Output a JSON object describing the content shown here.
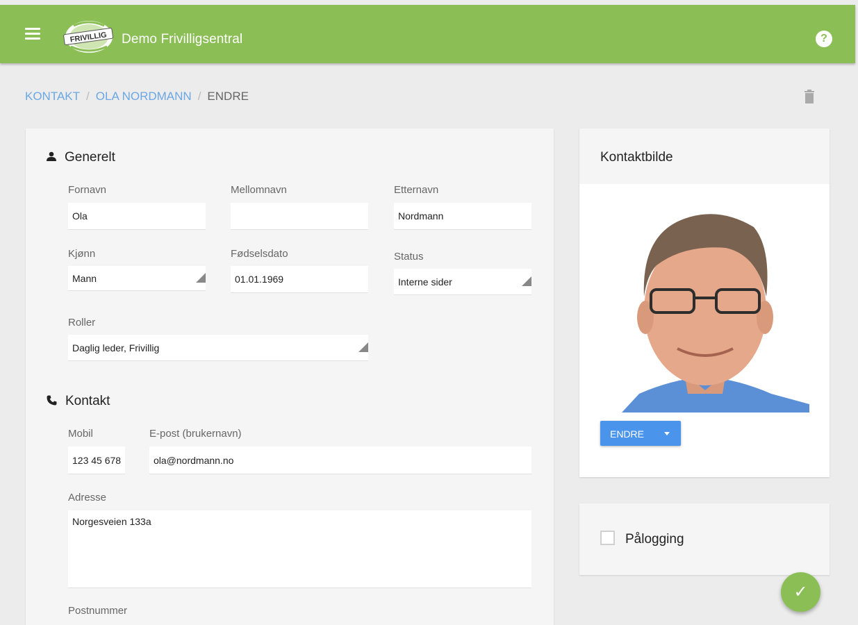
{
  "app": {
    "title": "Demo Frivilligsentral",
    "logo_text": "FRIVILLIG",
    "help_glyph": "?",
    "colors": {
      "accent": "#8bbf55",
      "link": "#6aa7e4",
      "primary_button": "#4a94ec"
    }
  },
  "breadcrumb": [
    {
      "label": "KONTAKT"
    },
    {
      "label": "OLA NORDMANN"
    },
    {
      "label": "ENDRE"
    }
  ],
  "general": {
    "title": "Generelt",
    "fornavn": {
      "label": "Fornavn",
      "value": "Ola"
    },
    "mellomnavn": {
      "label": "Mellomnavn",
      "value": ""
    },
    "etternavn": {
      "label": "Etternavn",
      "value": "Nordmann"
    },
    "kjonn": {
      "label": "Kjønn",
      "value": "Mann"
    },
    "fodselsdato": {
      "label": "Fødselsdato",
      "value": "01.01.1969"
    },
    "status": {
      "label": "Status",
      "value": "Interne sider"
    },
    "roller": {
      "label": "Roller",
      "value": "Daglig leder, Frivillig"
    }
  },
  "contact": {
    "title": "Kontakt",
    "mobil": {
      "label": "Mobil",
      "value": "123 45 678"
    },
    "epost": {
      "label": "E-post (brukernavn)",
      "value": "ola@nordmann.no"
    },
    "adresse": {
      "label": "Adresse",
      "value": "Norgesveien 133a"
    },
    "postnummer": {
      "label": "Postnummer"
    }
  },
  "photo_panel": {
    "title": "Kontaktbilde",
    "button_label": "ENDRE"
  },
  "login_panel": {
    "label": "Pålogging",
    "checked": false
  },
  "fab_glyph": "✓"
}
